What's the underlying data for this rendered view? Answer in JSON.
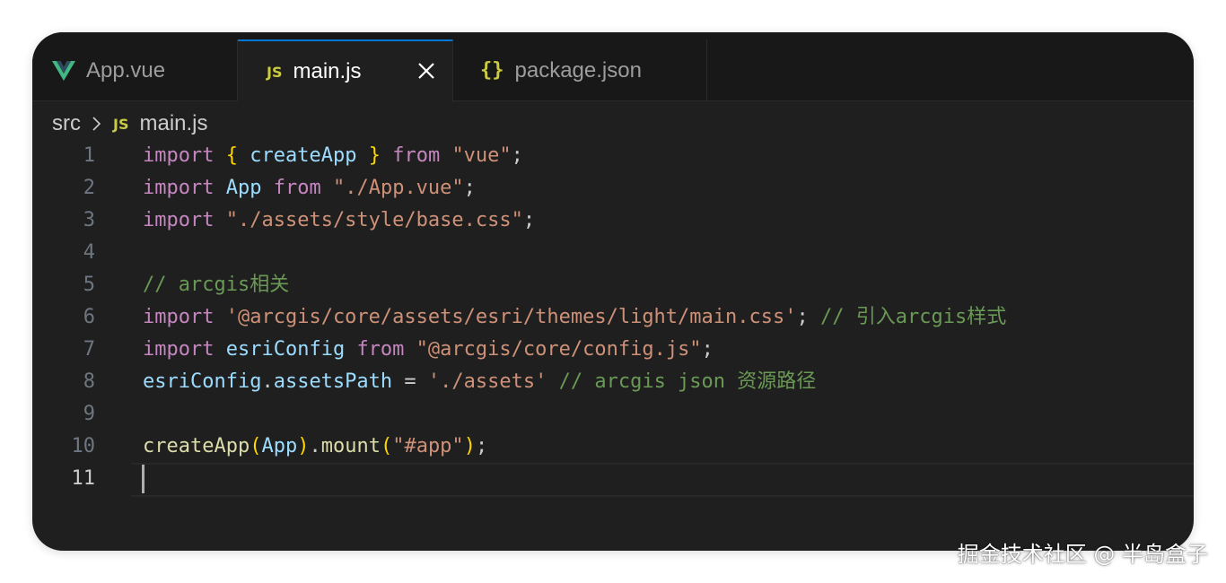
{
  "tabs": [
    {
      "label": "App.vue",
      "icon": "vue-icon",
      "active": false
    },
    {
      "label": "main.js",
      "icon": "js-icon",
      "icon_text": "JS",
      "active": true
    },
    {
      "label": "package.json",
      "icon": "json-icon",
      "icon_text": "{}",
      "active": false
    }
  ],
  "breadcrumb": {
    "folder": "src",
    "icon_text": "JS",
    "file": "main.js"
  },
  "code": {
    "lines": [
      {
        "n": "1",
        "tokens": [
          {
            "t": "import",
            "c": "kw"
          },
          {
            "t": " ",
            "c": "pl"
          },
          {
            "t": "{",
            "c": "br1"
          },
          {
            "t": " ",
            "c": "pl"
          },
          {
            "t": "createApp",
            "c": "var"
          },
          {
            "t": " ",
            "c": "pl"
          },
          {
            "t": "}",
            "c": "br1"
          },
          {
            "t": " ",
            "c": "pl"
          },
          {
            "t": "from",
            "c": "kw"
          },
          {
            "t": " ",
            "c": "pl"
          },
          {
            "t": "\"vue\"",
            "c": "str"
          },
          {
            "t": ";",
            "c": "pl"
          }
        ]
      },
      {
        "n": "2",
        "tokens": [
          {
            "t": "import",
            "c": "kw"
          },
          {
            "t": " ",
            "c": "pl"
          },
          {
            "t": "App",
            "c": "var"
          },
          {
            "t": " ",
            "c": "pl"
          },
          {
            "t": "from",
            "c": "kw"
          },
          {
            "t": " ",
            "c": "pl"
          },
          {
            "t": "\"./App.vue\"",
            "c": "str"
          },
          {
            "t": ";",
            "c": "pl"
          }
        ]
      },
      {
        "n": "3",
        "tokens": [
          {
            "t": "import",
            "c": "kw"
          },
          {
            "t": " ",
            "c": "pl"
          },
          {
            "t": "\"./assets/style/base.css\"",
            "c": "str"
          },
          {
            "t": ";",
            "c": "pl"
          }
        ]
      },
      {
        "n": "4",
        "tokens": []
      },
      {
        "n": "5",
        "tokens": [
          {
            "t": "// arcgis相关",
            "c": "cmt"
          }
        ]
      },
      {
        "n": "6",
        "tokens": [
          {
            "t": "import",
            "c": "kw"
          },
          {
            "t": " ",
            "c": "pl"
          },
          {
            "t": "'@arcgis/core/assets/esri/themes/light/main.css'",
            "c": "str"
          },
          {
            "t": "; ",
            "c": "pl"
          },
          {
            "t": "// 引入arcgis样式",
            "c": "cmt"
          }
        ]
      },
      {
        "n": "7",
        "tokens": [
          {
            "t": "import",
            "c": "kw"
          },
          {
            "t": " ",
            "c": "pl"
          },
          {
            "t": "esriConfig",
            "c": "var"
          },
          {
            "t": " ",
            "c": "pl"
          },
          {
            "t": "from",
            "c": "kw"
          },
          {
            "t": " ",
            "c": "pl"
          },
          {
            "t": "\"@arcgis/core/config.js\"",
            "c": "str"
          },
          {
            "t": ";",
            "c": "pl"
          }
        ]
      },
      {
        "n": "8",
        "tokens": [
          {
            "t": "esriConfig",
            "c": "var"
          },
          {
            "t": ".",
            "c": "pl"
          },
          {
            "t": "assetsPath",
            "c": "var"
          },
          {
            "t": " = ",
            "c": "pl"
          },
          {
            "t": "'./assets'",
            "c": "str"
          },
          {
            "t": " ",
            "c": "pl"
          },
          {
            "t": "// arcgis json 资源路径",
            "c": "cmt"
          }
        ]
      },
      {
        "n": "9",
        "tokens": []
      },
      {
        "n": "10",
        "tokens": [
          {
            "t": "createApp",
            "c": "fn"
          },
          {
            "t": "(",
            "c": "br1"
          },
          {
            "t": "App",
            "c": "var"
          },
          {
            "t": ")",
            "c": "br1"
          },
          {
            "t": ".",
            "c": "pl"
          },
          {
            "t": "mount",
            "c": "fn"
          },
          {
            "t": "(",
            "c": "br1"
          },
          {
            "t": "\"#app\"",
            "c": "str"
          },
          {
            "t": ")",
            "c": "br1"
          },
          {
            "t": ";",
            "c": "pl"
          }
        ]
      },
      {
        "n": "11",
        "tokens": [],
        "current": true
      }
    ]
  },
  "watermark": "掘金技术社区 @ 半岛盒子",
  "colors": {
    "editor_bg": "#1f1f1f",
    "tabbar_bg": "#181818",
    "active_tab_border": "#0078d4",
    "keyword": "#c586c0",
    "variable": "#9cdcfe",
    "string": "#ce9178",
    "comment": "#6a9955",
    "function": "#dcdcaa",
    "bracket": "#ffd700",
    "js_icon": "#cbcb41",
    "vue_icon": "#41b883"
  }
}
